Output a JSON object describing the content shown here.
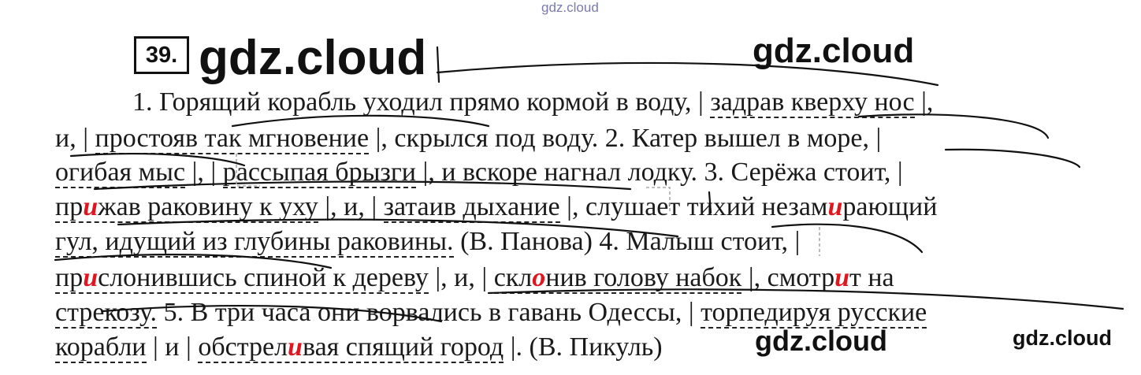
{
  "watermarks": {
    "top": "gdz.cloud",
    "big": "gdz.cloud",
    "right": "gdz.cloud",
    "bottom1": "gdz.cloud",
    "bottom2": "gdz.cloud"
  },
  "exercise_number": "39.",
  "lines": {
    "l1": {
      "a": "1. Горящий корабль уходил прямо кормой в воду, | ",
      "u1": "задрав кверху нос",
      "b": " |,"
    },
    "l2": {
      "a": "и, | ",
      "u1": "простояв так мгновение",
      "b": " |, скрылся под воду. 2. Катер вышел в море, |"
    },
    "l3": {
      "u1": "огибая мыс",
      "a": " |, | ",
      "u2": "рассыпая брызги",
      "b": " |, и вскоре нагнал лодку. 3. Серёжа стоит, |"
    },
    "l4": {
      "u1a": "пр",
      "h1": "и",
      "u1b": "жав раковину к уху",
      "a": " |, и, | ",
      "u2": "затаив дыхание",
      "b": " |, слушает тихий незам",
      "h2": "и",
      "c": "рающий"
    },
    "l5": {
      "u1": "гул, идущий из глубины раковины.",
      "a": " (В. Панова) 4. Малыш стоит, |"
    },
    "l6": {
      "u1a": "пр",
      "h1": "и",
      "u1b": "слонившись спиной к дереву",
      "a": " |, и, | ",
      "u2a": "скл",
      "h2": "о",
      "u2b": "нив голову набок",
      "b": " |, смотр",
      "h3": "и",
      "c": "т на"
    },
    "l7": {
      "u1": "стрекозу.",
      "a": " 5. В три часа они ворвались в гавань Одессы, | ",
      "u2": "торпедируя русские"
    },
    "l8": {
      "u1": "корабли",
      "a": " | и | ",
      "u2a": "обстрел",
      "h1": "и",
      "u2b": "вая спящий город",
      "b": " |. (В. Пикуль)"
    }
  },
  "colors": {
    "highlight": "#e0151e",
    "text": "#1a1a1a",
    "watermark_small": "#7a7ab0"
  }
}
